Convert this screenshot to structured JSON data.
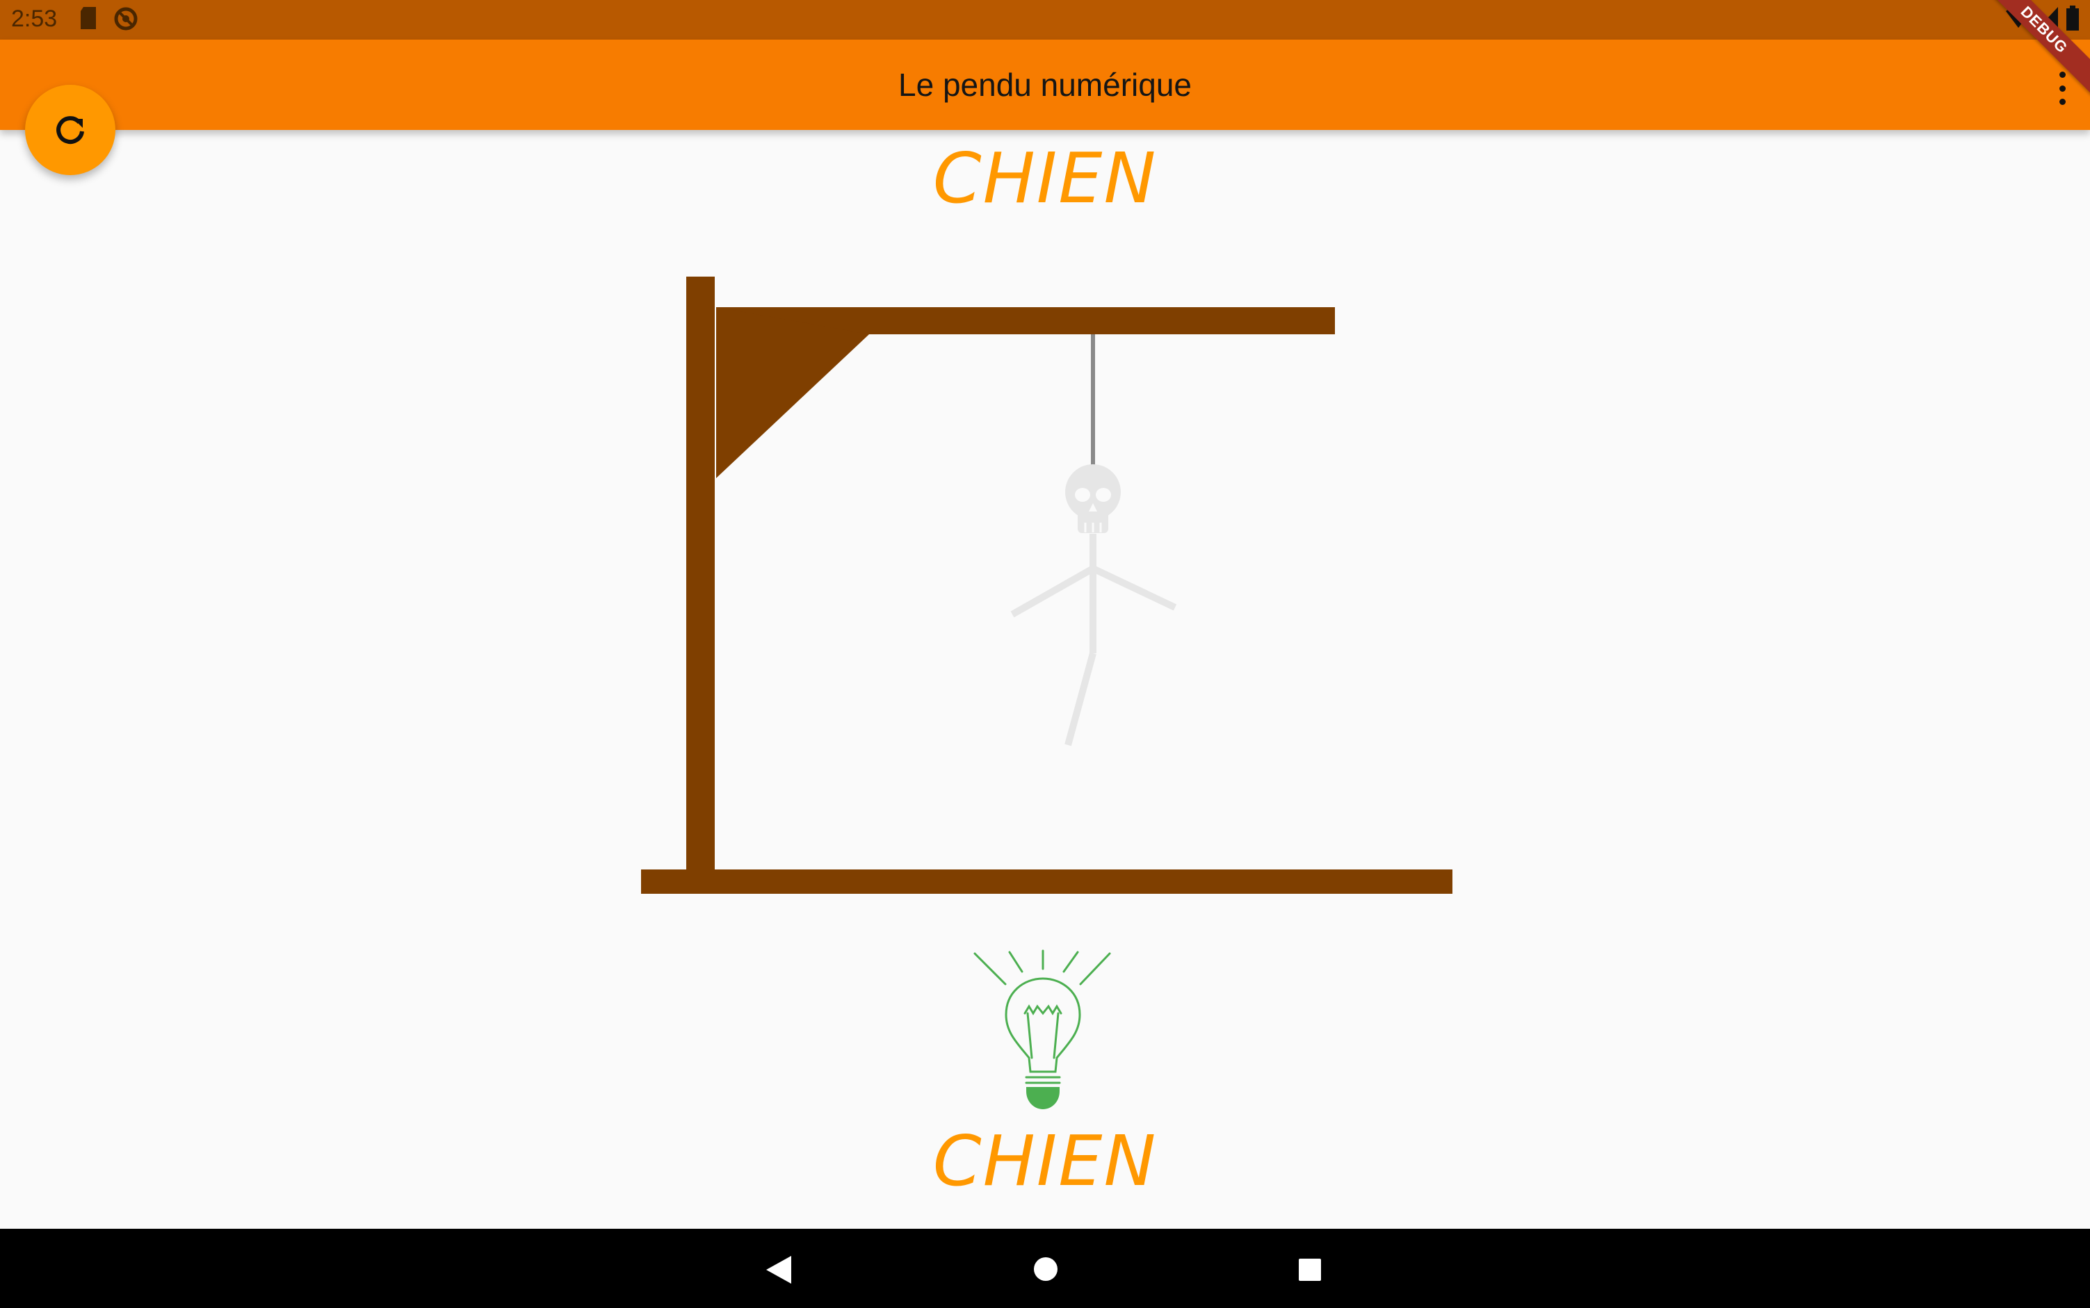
{
  "status_bar": {
    "time": "2:53",
    "icons_left": [
      "sd-card-icon",
      "sync-icon"
    ],
    "icons_right": [
      "wifi-icon",
      "signal-icon",
      "battery-icon"
    ]
  },
  "app_bar": {
    "title": "Le pendu numérique",
    "menu_icon": "more-vert-icon"
  },
  "fab": {
    "icon": "refresh-icon"
  },
  "debug_banner": "DEBUG",
  "game": {
    "word_top": "CHIEN",
    "word_bottom": "CHIEN",
    "hint_icon": "lightbulb-icon"
  },
  "nav_bar": {
    "buttons": [
      "back-icon",
      "home-icon",
      "recents-icon"
    ]
  },
  "colors": {
    "status_bar": "#b85900",
    "app_bar": "#f77c00",
    "accent": "#ff9800",
    "gallows": "#7f3f00",
    "rope": "#8a8a8a",
    "figure": "#e6e6e6",
    "hint": "#4caf50"
  }
}
